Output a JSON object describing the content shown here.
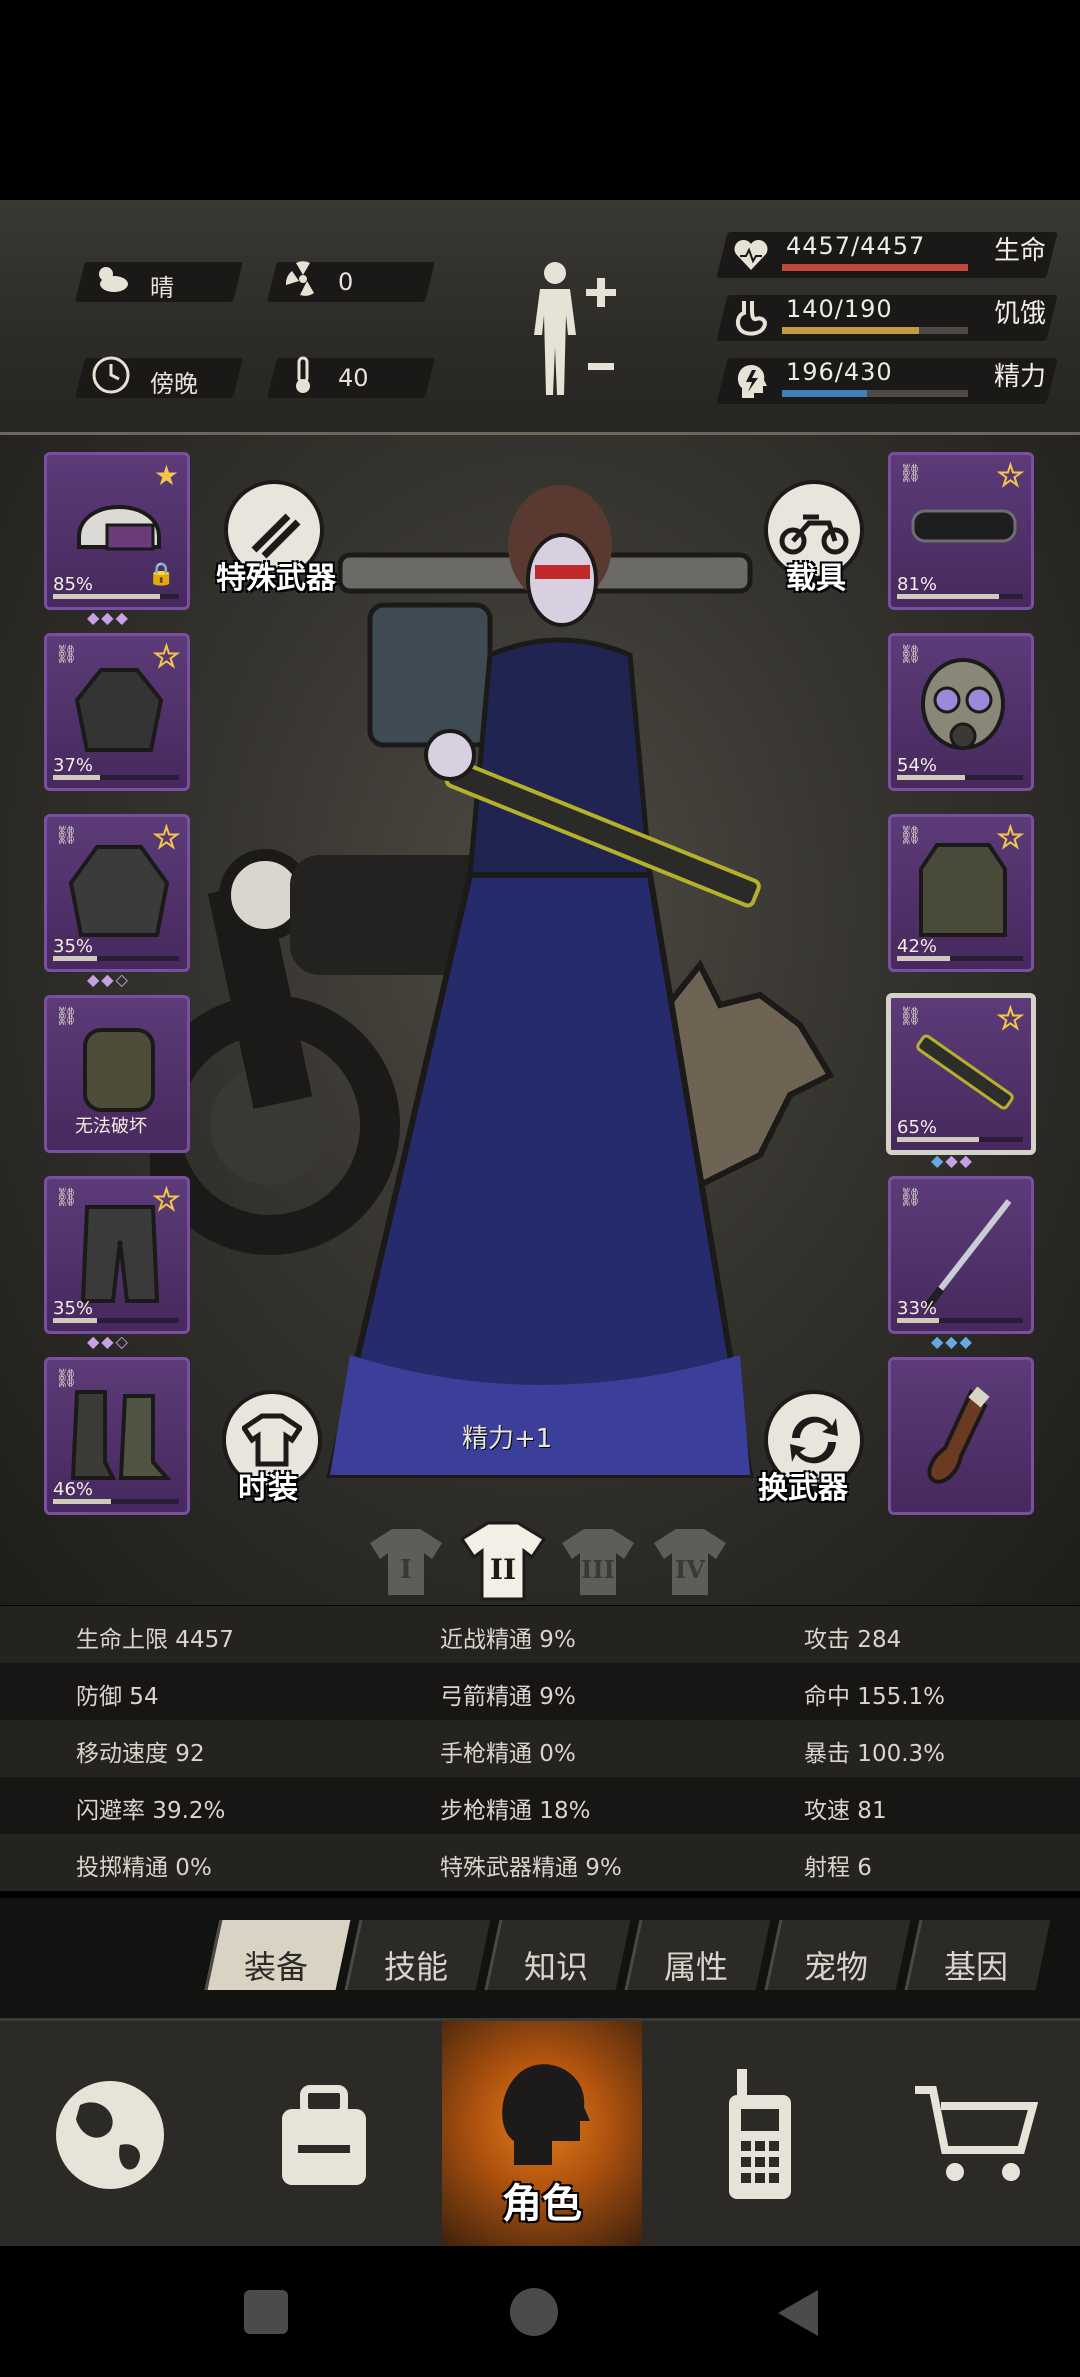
{
  "status": {
    "weather": "晴",
    "radiation": "0",
    "time_of_day": "傍晚",
    "temperature": "40",
    "vitals": [
      {
        "value": "4457/4457",
        "label": "生命",
        "fill": 1.0,
        "color": "#c0493a"
      },
      {
        "value": "140/190",
        "label": "饥饿",
        "fill": 0.737,
        "color": "#c59a45"
      },
      {
        "value": "196/430",
        "label": "精力",
        "fill": 0.456,
        "color": "#3f7fbd"
      }
    ]
  },
  "equipment": {
    "left_slots": [
      {
        "label": "85%",
        "fill": 0.85,
        "icon": "helmet-icon"
      },
      {
        "label": "37%",
        "fill": 0.37,
        "icon": "jacket-icon"
      },
      {
        "label": "35%",
        "fill": 0.35,
        "icon": "coat-icon"
      },
      {
        "label": "无法破坏",
        "fill": 0,
        "icon": "backpack-icon"
      },
      {
        "label": "35%",
        "fill": 0.35,
        "icon": "pants-icon"
      },
      {
        "label": "46%",
        "fill": 0.46,
        "icon": "boots-icon"
      }
    ],
    "right_slots": [
      {
        "label": "81%",
        "fill": 0.81,
        "icon": "goggles-icon"
      },
      {
        "label": "54%",
        "fill": 0.54,
        "icon": "gas-mask-icon"
      },
      {
        "label": "42%",
        "fill": 0.42,
        "icon": "vest-icon"
      },
      {
        "label": "65%",
        "fill": 0.65,
        "icon": "rifle-icon"
      },
      {
        "label": "33%",
        "fill": 0.33,
        "icon": "katana-icon"
      },
      {
        "label": "",
        "fill": 0,
        "icon": "molotov-icon"
      }
    ],
    "special_weapon_label": "特殊武器",
    "vehicle_label": "载具",
    "fashion_label": "时装",
    "swap_weapon_label": "换武器",
    "bonus_text": "精力+1",
    "outfit_tabs": [
      "I",
      "II",
      "III",
      "IV"
    ]
  },
  "stats": [
    [
      "生命上限 4457",
      "近战精通 9%",
      "攻击 284"
    ],
    [
      "防御 54",
      "弓箭精通 9%",
      "命中 155.1%"
    ],
    [
      "移动速度 92",
      "手枪精通 0%",
      "暴击 100.3%"
    ],
    [
      "闪避率 39.2%",
      "步枪精通 18%",
      "攻速 81"
    ],
    [
      "投掷精通 0%",
      "特殊武器精通 9%",
      "射程 6"
    ]
  ],
  "tabs": [
    "装备",
    "技能",
    "知识",
    "属性",
    "宠物",
    "基因"
  ],
  "nav": {
    "character_label": "角色"
  }
}
